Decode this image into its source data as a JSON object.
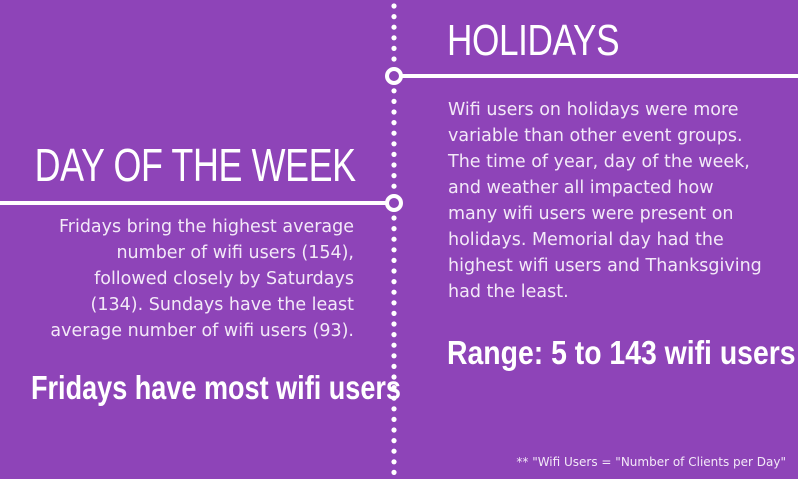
{
  "colors": {
    "background": "#8e44b8",
    "line": "#ffffff",
    "text": "#ffffff"
  },
  "left_section": {
    "heading": "DAY OF THE WEEK",
    "lines": [
      "Fridays bring the highest average",
      "number of wifi users (154),",
      "followed closely by Saturdays",
      "(134). Sundays have the least",
      "average number of wifi users (93)."
    ],
    "callout": "Fridays have most wifi users"
  },
  "right_section": {
    "heading": "HOLIDAYS",
    "lines": [
      "Wifi users on holidays were more",
      "variable than other event groups.",
      "The time of year, day of the week,",
      "and weather all impacted how",
      "many wifi users were present on",
      "holidays. Memorial day had the",
      "highest wifi users and Thanksgiving",
      "had the least."
    ],
    "callout": "Range: 5 to 143 wifi users"
  },
  "footnote": "** \"Wifi Users = \"Number of Clients per Day\""
}
